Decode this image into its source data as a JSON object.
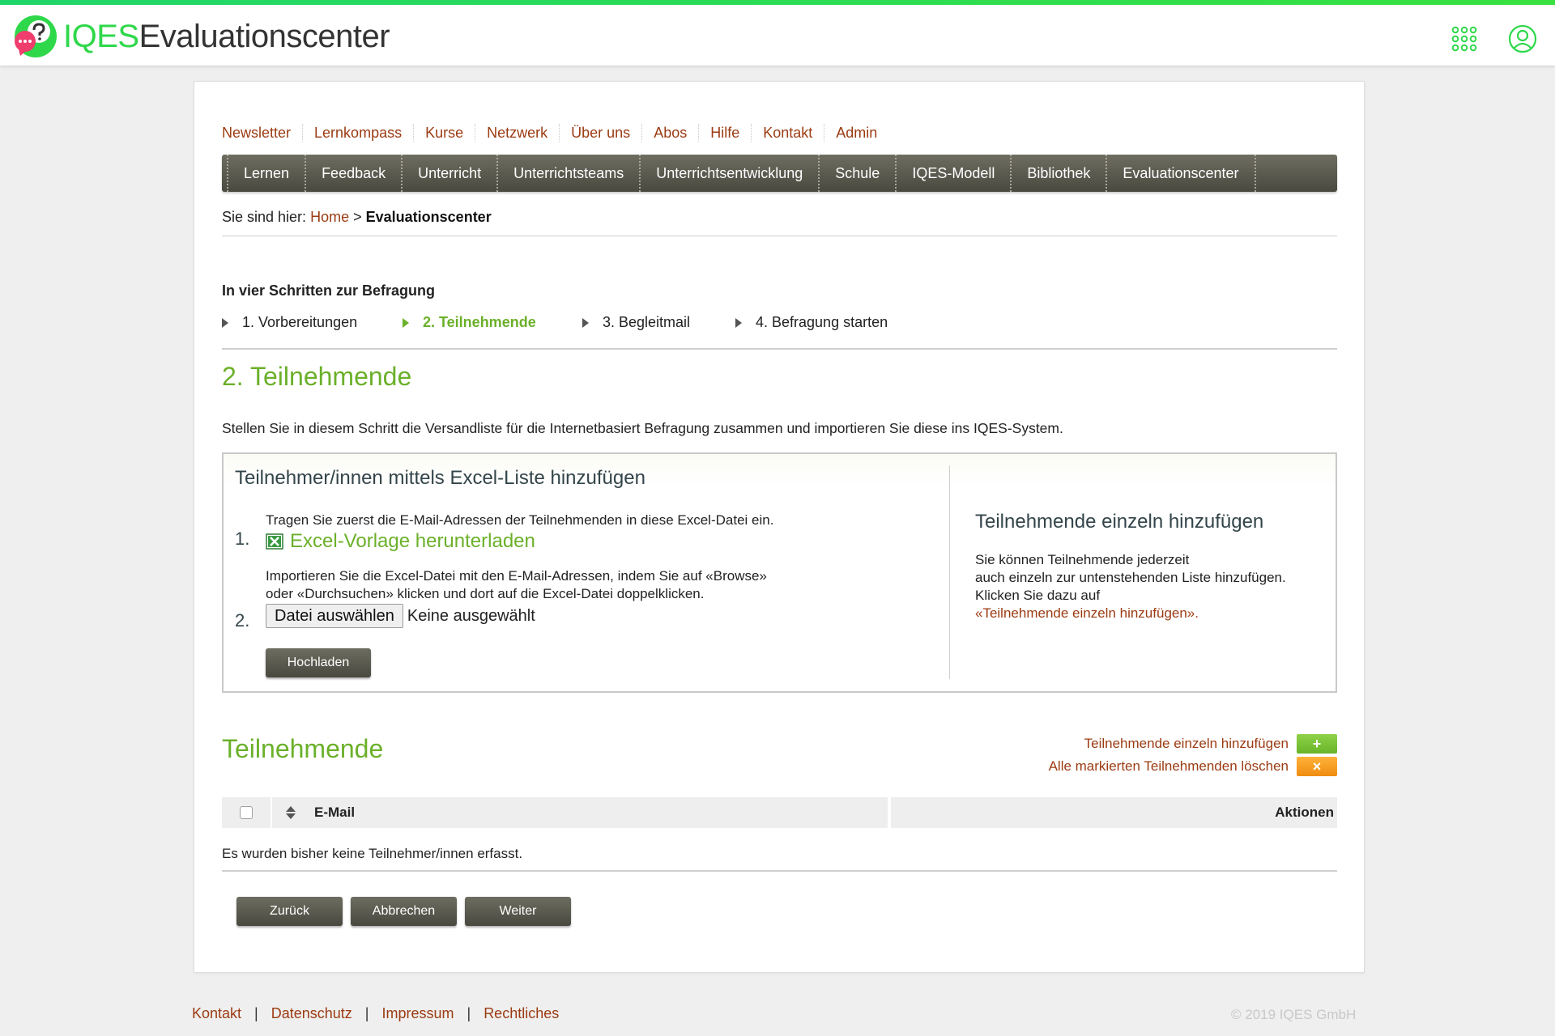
{
  "app": {
    "brand": "IQES",
    "name": "Evaluationscenter"
  },
  "topnav": [
    "Newsletter",
    "Lernkompass",
    "Kurse",
    "Netzwerk",
    "Über uns",
    "Abos",
    "Hilfe",
    "Kontakt",
    "Admin"
  ],
  "mainnav": [
    "Lernen",
    "Feedback",
    "Unterricht",
    "Unterrichtsteams",
    "Unterrichtsentwicklung",
    "Schule",
    "IQES-Modell",
    "Bibliothek",
    "Evaluationscenter"
  ],
  "breadcrumb": {
    "prefix": "Sie sind hier:",
    "home": "Home",
    "sep": ">",
    "current": "Evaluationscenter"
  },
  "steps": {
    "title": "In vier Schritten zur Befragung",
    "items": [
      "1. Vorbereitungen",
      "2. Teilnehmende",
      "3. Begleitmail",
      "4. Befragung starten"
    ],
    "active_index": 1
  },
  "page_title": "2. Teilnehmende",
  "intro": "Stellen Sie in diesem Schritt die Versandliste für die Internetbasiert Befragung zusammen und importieren Sie diese ins IQES-System.",
  "upload": {
    "heading": "Teilnehmer/innen mittels Excel-Liste hinzufügen",
    "step1_num": "1.",
    "step1_text": "Tragen Sie zuerst die E-Mail-Adressen der Teilnehmenden in diese Excel-Datei ein.",
    "excel_link": "Excel-Vorlage herunterladen",
    "step2_line1": "Importieren Sie die Excel-Datei mit den E-Mail-Adressen, indem Sie auf «Browse»",
    "step2_line2": "oder «Durchsuchen» klicken und dort auf die Excel-Datei doppelklicken.",
    "step2_num": "2.",
    "file_button": "Datei auswählen",
    "file_status": "Keine ausgewählt",
    "upload_button": "Hochladen"
  },
  "single": {
    "heading": "Teilnehmende einzeln hinzufügen",
    "line1": "Sie können Teilnehmende jederzeit",
    "line2": "auch einzeln zur untenstehenden Liste hinzufügen.",
    "line3": "Klicken Sie dazu auf",
    "link": "«Teilnehmende einzeln hinzufügen»."
  },
  "participants": {
    "title": "Teilnehmende",
    "add_label": "Teilnehmende einzeln hinzufügen",
    "add_symbol": "+",
    "delete_label": "Alle markierten Teilnehmenden löschen",
    "delete_symbol": "×",
    "col_email": "E-Mail",
    "col_actions": "Aktionen",
    "empty": "Es wurden bisher keine Teilnehmer/innen erfasst."
  },
  "buttons": {
    "back": "Zurück",
    "cancel": "Abbrechen",
    "next": "Weiter"
  },
  "footer": {
    "links": [
      "Kontakt",
      "Datenschutz",
      "Impressum",
      "Rechtliches"
    ],
    "separator": "|",
    "copyright": "© 2019 IQES GmbH"
  },
  "colors": {
    "accent_green": "#6bb02a",
    "brand_green": "#2ed84a",
    "link_brown": "#9b3b12",
    "add_button": "#7dc43a",
    "delete_button": "#f39a1d",
    "nav_dark": "#55544a"
  },
  "icons": {
    "apps": "grid-apps-icon",
    "user": "user-icon",
    "excel": "excel-file-icon",
    "sort": "sort-icon",
    "step": "triangle-right-icon"
  }
}
